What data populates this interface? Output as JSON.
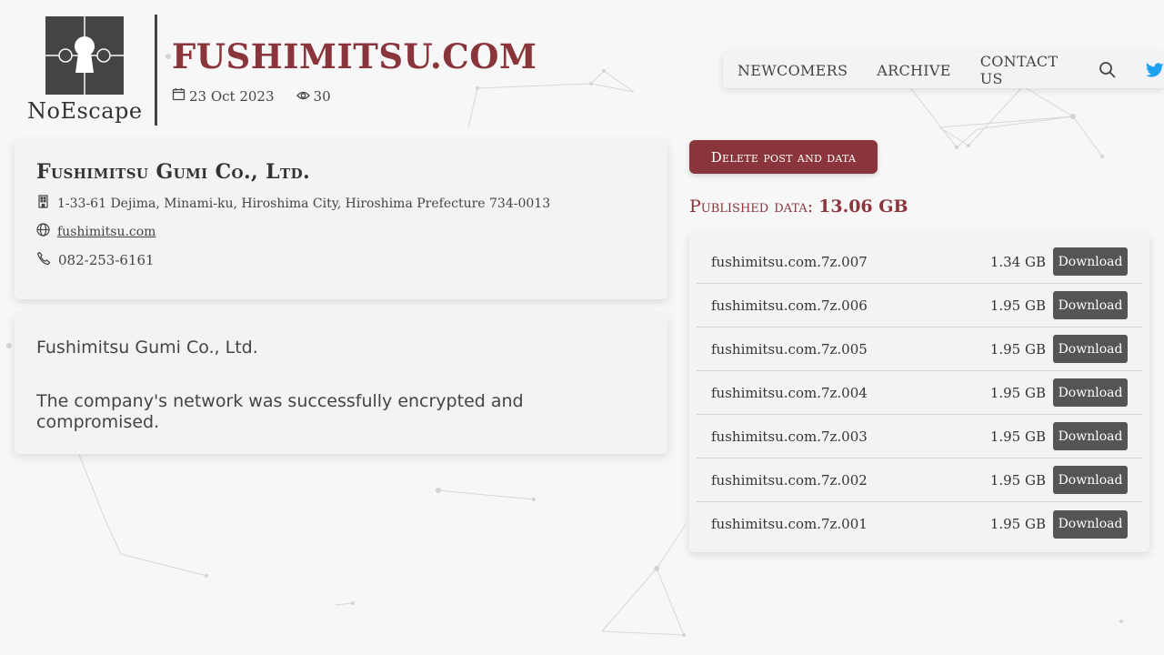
{
  "logo": {
    "text": "NoEscape"
  },
  "site": {
    "title": "FUSHIMITSU.COM",
    "date": "23 Oct 2023",
    "views": "30"
  },
  "nav": {
    "items": [
      {
        "label": "NEWCOMERS"
      },
      {
        "label": "ARCHIVE"
      },
      {
        "label": "CONTACT US"
      }
    ],
    "search_icon": "search-icon",
    "social_icon": "twitter-icon",
    "social_color": "#1da1f2"
  },
  "company": {
    "name": "Fushimitsu Gumi Co., Ltd.",
    "address": "1-33-61 Dejima, Minami-ku, Hiroshima City, Hiroshima Prefecture 734-0013",
    "website": "fushimitsu.com",
    "phone": "082-253-6161"
  },
  "description": {
    "line1": "Fushimitsu Gumi Co., Ltd.",
    "line2": "The company's network was successfully encrypted and compromised."
  },
  "actions": {
    "delete_label": "Delete post and data"
  },
  "published": {
    "label": "Published data:",
    "size": "13.06 GB"
  },
  "files": [
    {
      "name": "fushimitsu.com.7z.007",
      "size": "1.34 GB",
      "button": "Download"
    },
    {
      "name": "fushimitsu.com.7z.006",
      "size": "1.95 GB",
      "button": "Download"
    },
    {
      "name": "fushimitsu.com.7z.005",
      "size": "1.95 GB",
      "button": "Download"
    },
    {
      "name": "fushimitsu.com.7z.004",
      "size": "1.95 GB",
      "button": "Download"
    },
    {
      "name": "fushimitsu.com.7z.003",
      "size": "1.95 GB",
      "button": "Download"
    },
    {
      "name": "fushimitsu.com.7z.002",
      "size": "1.95 GB",
      "button": "Download"
    },
    {
      "name": "fushimitsu.com.7z.001",
      "size": "1.95 GB",
      "button": "Download"
    }
  ],
  "colors": {
    "accent": "#8a353b",
    "button_dark": "#555555",
    "background": "#f7f7f7"
  }
}
